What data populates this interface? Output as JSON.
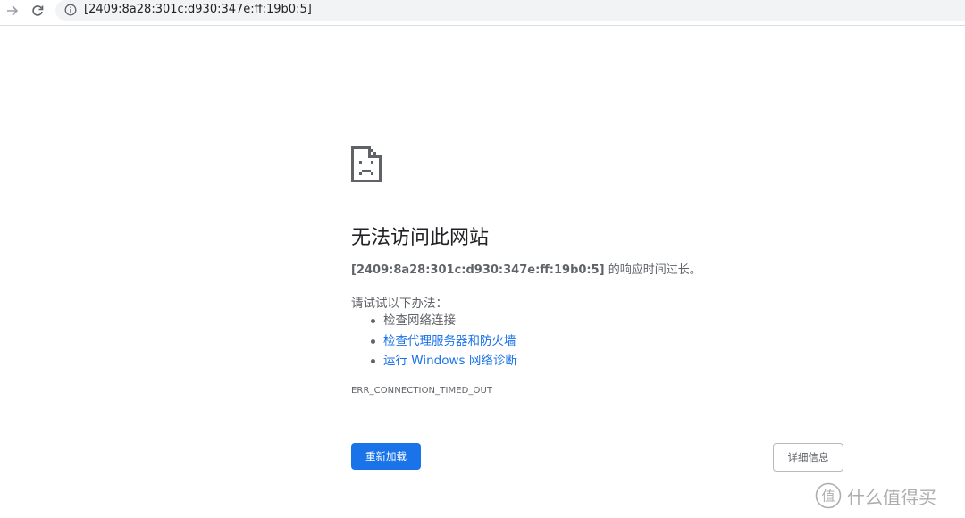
{
  "browser": {
    "url": "[2409:8a28:301c:d930:347e:ff:19b0:5]",
    "icons": {
      "forward": "forward-arrow-icon",
      "reload": "reload-icon",
      "site_info": "info-icon"
    }
  },
  "error_page": {
    "icon": "sad-document-icon",
    "heading": "无法访问此网站",
    "summary_host": "[2409:8a28:301c:d930:347e:ff:19b0:5]",
    "summary_text": " 的响应时间过长。",
    "suggestions_title": "请试试以下办法：",
    "suggestions": [
      {
        "label": "检查网络连接",
        "link": false
      },
      {
        "label": "检查代理服务器和防火墙",
        "link": true
      },
      {
        "label": "运行 Windows 网络诊断",
        "link": true
      }
    ],
    "error_code": "ERR_CONNECTION_TIMED_OUT",
    "reload_label": "重新加载",
    "details_label": "详细信息"
  },
  "watermark": {
    "text": "什么值得买",
    "logo_text": "值"
  },
  "colors": {
    "accent": "#1a73e8",
    "text_secondary": "#5f6368",
    "omnibox_bg": "#f1f3f4"
  }
}
